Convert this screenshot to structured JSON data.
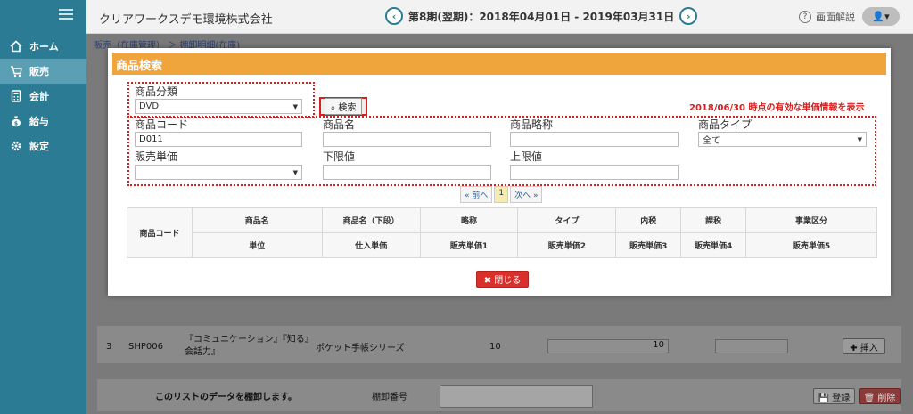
{
  "header": {
    "company": "クリアワークスデモ環境株式会社",
    "period": "第8期(翌期)：2018年04月01日 - 2019年03月31日",
    "prev_icon": "‹",
    "next_icon": "›",
    "help_icon": "?",
    "help_label": "画面解説",
    "user_icon": "👤▾"
  },
  "sidebar": {
    "items": [
      {
        "label": "ホーム",
        "icon": "home-icon"
      },
      {
        "label": "販売",
        "icon": "cart-icon"
      },
      {
        "label": "会計",
        "icon": "calculator-icon"
      },
      {
        "label": "給与",
        "icon": "money-bag-icon"
      },
      {
        "label": "設定",
        "icon": "gear-icon"
      }
    ]
  },
  "background": {
    "breadcrumb": "販売（在庫管理） ＞ 棚卸明細(在庫)",
    "row": {
      "no": "3",
      "code": "SHP006",
      "name": "『コミュニケーション』『知る』会話力』",
      "series": "ポケット手帳シリーズ",
      "qty": "10",
      "qty2": "10",
      "insert_label": "✚ 挿入"
    },
    "footer": {
      "message": "このリストのデータを棚卸します。",
      "number_label": "棚卸番号",
      "register_label": "💾 登録",
      "delete_label": "🗑 削除"
    }
  },
  "modal": {
    "title": "商品検索",
    "category_label": "商品分類",
    "category_value": "DVD",
    "search_label": "⌕ 検索",
    "notice": "2018/06/30 時点の有効な単価情報を表示",
    "code_label": "商品コード",
    "code_value": "D011",
    "name_label": "商品名",
    "abbr_label": "商品略称",
    "type_label": "商品タイプ",
    "type_value": "全て",
    "price_label": "販売単価",
    "lower_label": "下限値",
    "upper_label": "上限値",
    "pager": {
      "prev": "« 前へ",
      "page": "1",
      "next": "次へ »"
    },
    "table": {
      "row1": [
        "商品コード",
        "商品名",
        "商品名（下段）",
        "略称",
        "タイプ",
        "内税",
        "課税",
        "事業区分"
      ],
      "row2": [
        "単位",
        "仕入単価",
        "販売単価1",
        "販売単価2",
        "販売単価3",
        "販売単価4",
        "販売単価5"
      ]
    },
    "close_label": "✖ 閉じる"
  },
  "colors": {
    "sidebar": "#2b7b95",
    "modal_header": "#f0a43c",
    "highlight_red": "#d61f1f",
    "close_button": "#d9302c"
  }
}
